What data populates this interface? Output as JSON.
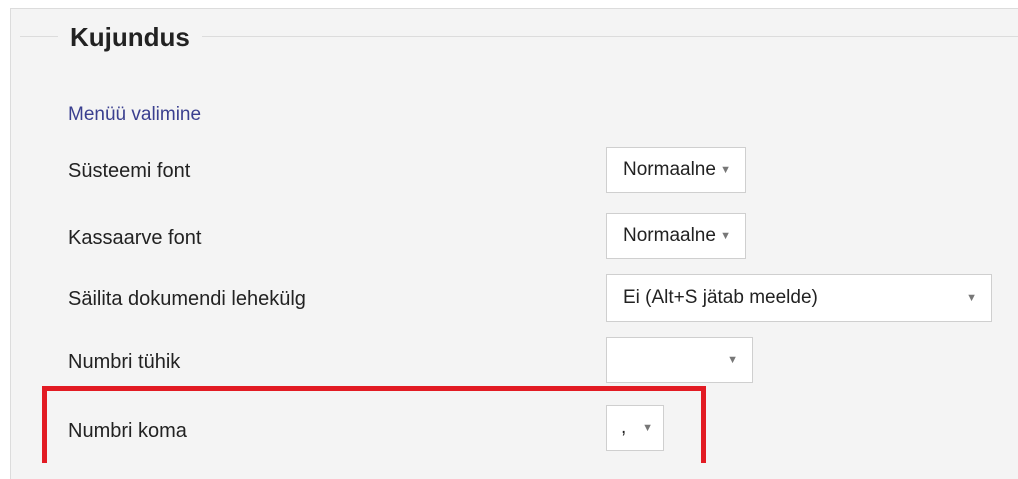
{
  "section": {
    "legend": "Kujundus"
  },
  "menu_link": "Menüü valimine",
  "rows": [
    {
      "label": "Süsteemi font",
      "value": "Normaalne"
    },
    {
      "label": "Kassaarve font",
      "value": "Normaalne"
    },
    {
      "label": "Säilita dokumendi lehekülg",
      "value": "Ei (Alt+S jätab meelde)"
    },
    {
      "label": "Numbri tühik",
      "value": ""
    },
    {
      "label": "Numbri koma",
      "value": ","
    }
  ],
  "colors": {
    "highlight": "#e21b23",
    "link": "#3a3f8f",
    "panel": "#f4f4f4"
  },
  "icons": {
    "dropdown": "chevron-down-icon"
  }
}
